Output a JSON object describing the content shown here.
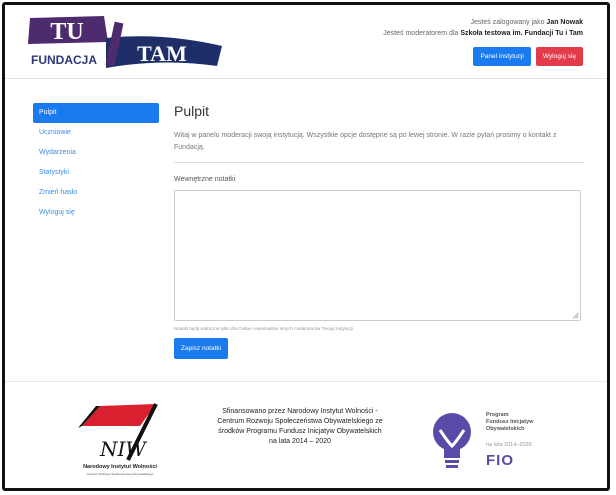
{
  "header": {
    "logo_top": "TU",
    "logo_left": "FUNDACJA",
    "logo_right": "TAM",
    "logged_in_prefix": "Jesteś zalogowany jako",
    "user_name": "Jan Nowak",
    "moderator_prefix": "Jesteś moderatorem dla",
    "institution": "Szkoła testowa im. Fundacji Tu i Tam",
    "panel_button": "Panel instytucji",
    "logout_button": "Wyloguj się"
  },
  "sidebar": {
    "items": [
      {
        "label": "Pulpit",
        "active": true
      },
      {
        "label": "Uczniowie"
      },
      {
        "label": "Wydarzenia"
      },
      {
        "label": "Statystyki"
      },
      {
        "label": "Zmień hasło"
      },
      {
        "label": "Wyloguj się"
      }
    ]
  },
  "main": {
    "title": "Pulpit",
    "intro": "Witaj w panelu moderacji swoją instytucją. Wszystkie opcje dostępne są po lewej stronie. W razie pytań prosimy o kontakt z Fundacją.",
    "notes_label": "Wewnętrzne notatki",
    "notes_value": "",
    "notes_hint": "Notatki będą widoczne tylko dla Ciebie i ewentualnie innych moderatorów Twojej instytucji.",
    "save_button": "Zapisz notatki"
  },
  "footer": {
    "niw_logo_text": "NIW",
    "niw_name": "Narodowy Instytut Wolności",
    "niw_subtitle": "Centrum Rozwoju Społeczeństwa Obywatelskiego",
    "funding_text": "Sfinansowano przez Narodowy Instytut Wolności - Centrum Rozwoju Społeczeństwa Obywatelskiego ze środków Programu Fundusz Inicjatyw Obywatelskich na lata 2014 – 2020",
    "fio_line1": "Program",
    "fio_line2": "Fundusz Inicjatyw",
    "fio_line3": "Obywatelskich",
    "fio_years": "na lata 2014–2020",
    "fio_word": "FIO"
  },
  "colors": {
    "primary": "#1a7bef",
    "danger": "#e23b4a",
    "link": "#3a8ee6",
    "logo_purple": "#4e2a6e",
    "logo_navy": "#1e2e68"
  }
}
